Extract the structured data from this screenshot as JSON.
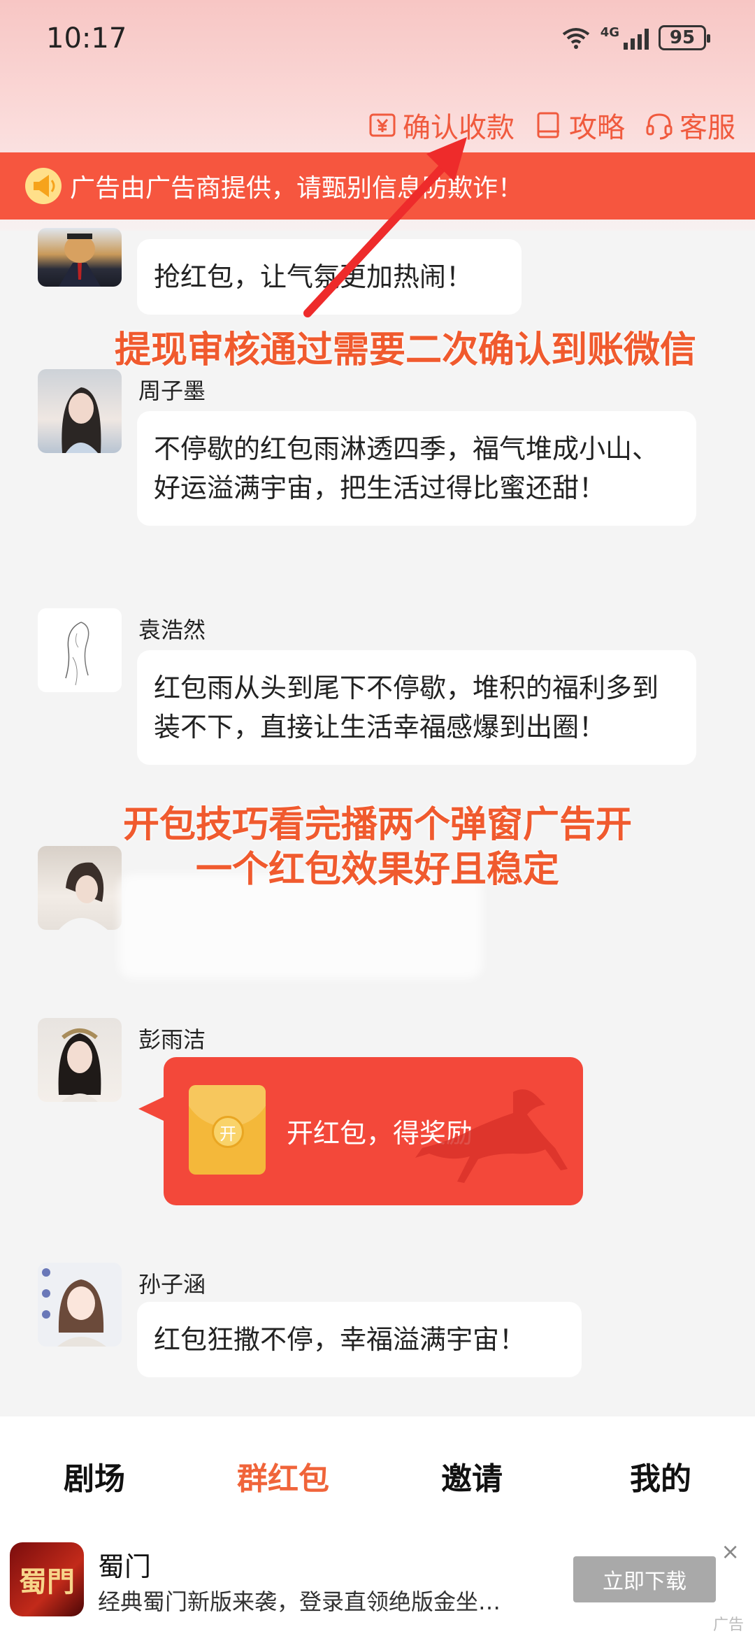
{
  "status_bar": {
    "time": "10:17",
    "network": "4G",
    "battery": "95"
  },
  "header": {
    "confirm_label": "确认收款",
    "guide_label": "攻略",
    "service_label": "客服"
  },
  "notice": {
    "text": "广告由广告商提供，请甄别信息防欺诈！"
  },
  "messages": [
    {
      "sender": "",
      "text": "抢红包，让气氛更加热闹！"
    },
    {
      "sender": "周子墨",
      "text": "不停歇的红包雨淋透四季，福气堆成小山、好运溢满宇宙，把生活过得比蜜还甜！"
    },
    {
      "sender": "袁浩然",
      "text": "红包雨从头到尾下不停歇，堆积的福利多到装不下，直接让生活幸福感爆到出圈！"
    },
    {
      "sender": "彭雨洁",
      "text": ""
    },
    {
      "sender": "孙子涵",
      "text": "红包狂撒不停，幸福溢满宇宙！"
    }
  ],
  "red_packet": {
    "label": "开红包，得奖励",
    "coin": "开"
  },
  "overlays": {
    "tip1": "提现审核通过需要二次确认到账微信",
    "tip2_line1": "开包技巧看完播两个弹窗广告开",
    "tip2_line2": "一个红包效果好且稳定"
  },
  "bottom_nav": {
    "items": [
      "剧场",
      "群红包",
      "邀请",
      "我的"
    ],
    "active_index": 1
  },
  "ad": {
    "icon_text": "蜀門",
    "title": "蜀门",
    "desc": "经典蜀门新版来袭，登录直领绝版金坐…",
    "button": "立即下载",
    "close": "×",
    "tag": "广告"
  },
  "colors": {
    "accent": "#f0643a",
    "banner": "#f6563f",
    "packet": "#f3483a"
  }
}
